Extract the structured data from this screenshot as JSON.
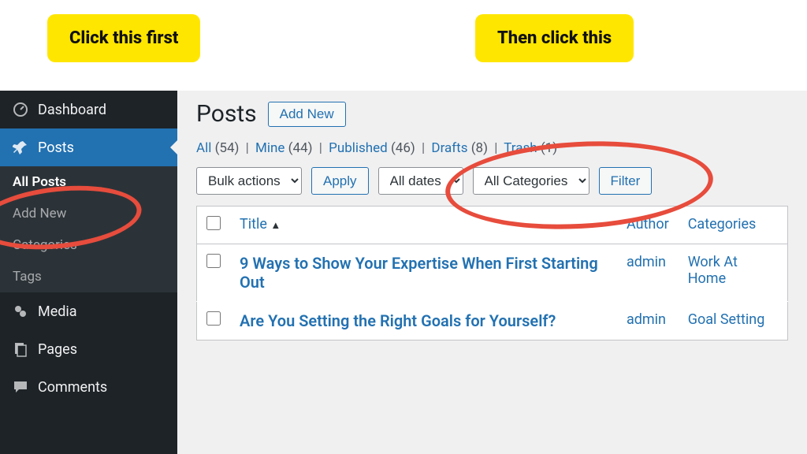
{
  "annotations": {
    "callout1": "Click this first",
    "callout2": "Then click this"
  },
  "sidebar": {
    "dashboard": "Dashboard",
    "posts": "Posts",
    "sub": {
      "all_posts": "All Posts",
      "add_new": "Add New",
      "categories": "Categories",
      "tags": "Tags"
    },
    "media": "Media",
    "pages": "Pages",
    "comments": "Comments"
  },
  "header": {
    "title": "Posts",
    "add_new_btn": "Add New"
  },
  "filters": {
    "all": {
      "label": "All",
      "count": "(54)"
    },
    "mine": {
      "label": "Mine",
      "count": "(44)"
    },
    "published": {
      "label": "Published",
      "count": "(46)"
    },
    "drafts": {
      "label": "Drafts",
      "count": "(8)"
    },
    "trash": {
      "label": "Trash",
      "count": "(1)"
    }
  },
  "toolbar": {
    "bulk_actions": "Bulk actions",
    "apply": "Apply",
    "all_dates": "All dates",
    "all_categories": "All Categories",
    "filter": "Filter"
  },
  "table": {
    "headers": {
      "title": "Title",
      "author": "Author",
      "categories": "Categories"
    },
    "rows": [
      {
        "title": "9 Ways to Show Your Expertise When First Starting Out",
        "author": "admin",
        "category": "Work At Home"
      },
      {
        "title": "Are You Setting the Right Goals for Yourself?",
        "author": "admin",
        "category": "Goal Setting"
      }
    ]
  }
}
